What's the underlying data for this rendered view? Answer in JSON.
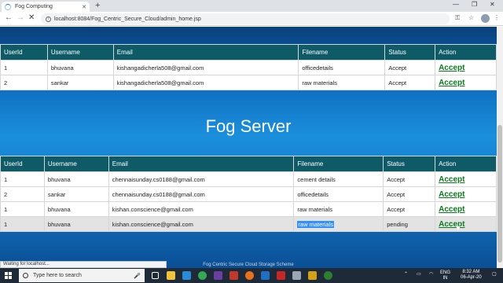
{
  "browser": {
    "tab_title": "Fog Computing",
    "url": "localhost:8084/Fog_Centric_Secure_Cloud/admin_home.jsp",
    "status": "Waiting for localhost..."
  },
  "table1": {
    "headers": [
      "UserId",
      "Username",
      "Email",
      "Filename",
      "Status",
      "Action"
    ],
    "rows": [
      [
        "1",
        "bhuvana",
        "kishangadicherla508@gmail.com",
        "officedetails",
        "Accept",
        "Accept"
      ],
      [
        "2",
        "sankar",
        "kishangadicherla508@gmail.com",
        "raw materials",
        "Accept",
        "Accept"
      ]
    ]
  },
  "server_title": "Fog Server",
  "table2": {
    "headers": [
      "UserId",
      "Username",
      "Email",
      "Filename",
      "Status",
      "Action"
    ],
    "rows": [
      [
        "1",
        "bhuvana",
        "chennaisunday.cs0188@gmail.com",
        "cement details",
        "Accept",
        "Accept"
      ],
      [
        "2",
        "sankar",
        "chennaisunday.cs0188@gmail.com",
        "officedetails",
        "Accept",
        "Accept"
      ],
      [
        "1",
        "bhuvana",
        "kishan.conscience@gmail.com",
        "raw materials",
        "Accept",
        "Accept"
      ],
      [
        "1",
        "bhuvana",
        "kishan.conscience@gmail.com",
        "raw materials",
        "pending",
        "Accept"
      ]
    ]
  },
  "footer": "Fog Centric Secure Cloud Storage Scheme",
  "taskbar": {
    "search_placeholder": "Type here to search",
    "lang": "ENG",
    "region": "IN",
    "time": "8:32 AM",
    "date": "06-Apr-20"
  },
  "colors": {
    "header_bg": "#0e5a67",
    "accept_link": "#0a7b1f",
    "page_gradient": "#1b8fdc"
  }
}
